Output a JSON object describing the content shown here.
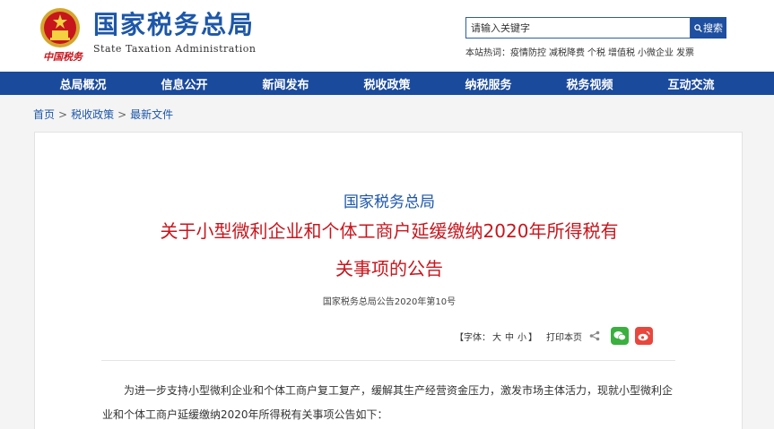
{
  "header": {
    "calligraphy": "中国税务",
    "title": "国家税务总局",
    "subtitle": "State Taxation Administration"
  },
  "search": {
    "placeholder": "请输入关键字",
    "button_label": "搜索",
    "hot_label": "本站热词：",
    "hot_words": [
      "疫情防控",
      "减税降费",
      "个税",
      "增值税",
      "小微企业",
      "发票"
    ]
  },
  "nav": {
    "items": [
      "总局概况",
      "信息公开",
      "新闻发布",
      "税收政策",
      "纳税服务",
      "税务视频",
      "互动交流"
    ]
  },
  "breadcrumb": {
    "items": [
      "首页",
      "税收政策",
      "最新文件"
    ],
    "separator": ">"
  },
  "article": {
    "issuer": "国家税务总局",
    "title_line1": "关于小型微利企业和个体工商户延缓缴纳2020年所得税有",
    "title_line2": "关事项的公告",
    "doc_number": "国家税务总局公告2020年第10号",
    "tools": {
      "font_label": "【字体：",
      "font_large": "大",
      "font_medium": "中",
      "font_small": "小",
      "font_close": "】",
      "print": "打印本页"
    },
    "body": "为进一步支持小型微利企业和个体工商户复工复产，缓解其生产经营资金压力，激发市场主体活力，现就小型微利企业和个体工商户延缓缴纳2020年所得税有关事项公告如下："
  },
  "colors": {
    "brand_blue": "#1a4a9c",
    "title_red": "#c8161d",
    "link_blue": "#1d57a8",
    "wechat_green": "#3ab03e",
    "weibo_red": "#e8473d"
  },
  "icons": [
    "national-emblem-icon",
    "search-icon",
    "share-icon",
    "wechat-icon",
    "weibo-icon"
  ]
}
